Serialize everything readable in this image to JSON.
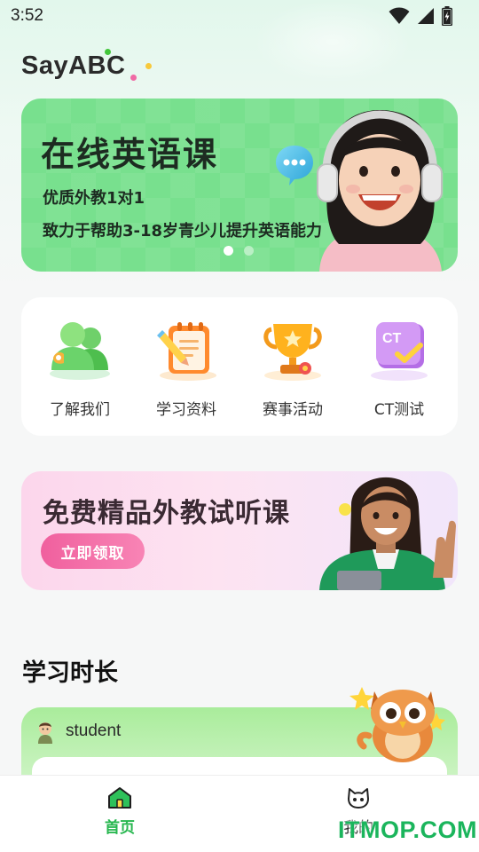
{
  "status_bar": {
    "time": "3:52"
  },
  "app": {
    "logo_text": "SayABC"
  },
  "banner": {
    "title": "在线英语课",
    "subtitle1": "优质外教1对1",
    "subtitle2": "致力于帮助3-18岁青少儿提升英语能力",
    "page_count": 2,
    "active_page": 1
  },
  "quick_links": [
    {
      "label": "了解我们",
      "icon": "people-icon"
    },
    {
      "label": "学习资料",
      "icon": "notebook-pencil-icon"
    },
    {
      "label": "赛事活动",
      "icon": "trophy-icon"
    },
    {
      "label": "CT测试",
      "icon": "ct-test-icon",
      "icon_text": "CT"
    }
  ],
  "promo": {
    "title": "免费精品外教试听课",
    "button_label": "立即领取"
  },
  "study_time": {
    "section_title": "学习时长",
    "student_name": "student"
  },
  "tab_bar": {
    "tabs": [
      {
        "label": "首页",
        "icon": "home-icon",
        "active": true
      },
      {
        "label": "我的",
        "icon": "cat-face-icon",
        "active": false
      }
    ]
  },
  "watermark": "ITMOP.COM",
  "colors": {
    "brand_green": "#27b74f",
    "banner_green": "#78e08e",
    "promo_pink": "#f0609e"
  }
}
